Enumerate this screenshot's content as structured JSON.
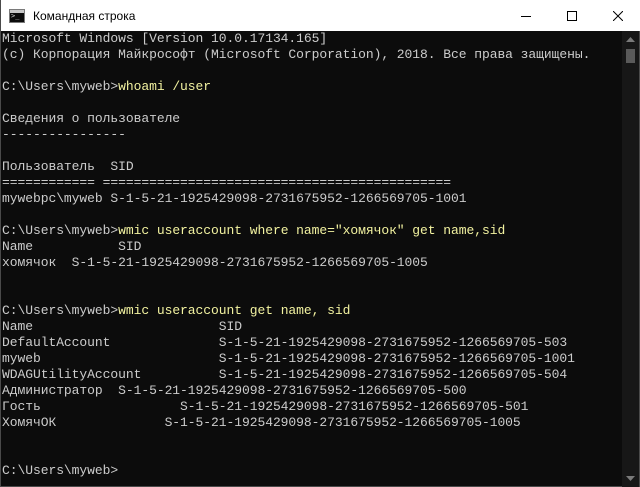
{
  "window": {
    "title": "Командная строка",
    "icon": "cmd-icon",
    "controls": [
      "minimize-icon",
      "maximize-icon",
      "close-icon"
    ]
  },
  "colors": {
    "background": "#0c0c0c",
    "text": "#cccccc",
    "command": "#f2f2a0",
    "titlebar": "#ffffff"
  },
  "console": {
    "header1": "Microsoft Windows [Version 10.0.17134.165]",
    "header2": "(c) Корпорация Майкрософт (Microsoft Corporation), 2018. Все права защищены.",
    "prompt1": "C:\\Users\\myweb>",
    "cmd1": "whoami /user",
    "info_title": "Сведения о пользователе",
    "info_rule": "----------------",
    "table_header": "Пользователь  SID",
    "table_rule": "============ =============================================",
    "table_row": "mywebpc\\myweb S-1-5-21-1925429098-2731675952-1266569705-1001",
    "prompt2": "C:\\Users\\myweb>",
    "cmd2": "wmic useraccount where name=\"хомячок\" get name,sid",
    "q2_header": "Name           SID",
    "q2_row": "хомячок  S-1-5-21-1925429098-2731675952-1266569705-1005",
    "prompt3": "C:\\Users\\myweb>",
    "cmd3": "wmic useraccount get name, sid",
    "q3_header": "Name                        SID",
    "q3_rows": [
      "DefaultAccount              S-1-5-21-1925429098-2731675952-1266569705-503",
      "myweb                       S-1-5-21-1925429098-2731675952-1266569705-1001",
      "WDAGUtilityAccount          S-1-5-21-1925429098-2731675952-1266569705-504",
      "Администратор  S-1-5-21-1925429098-2731675952-1266569705-500",
      "Гость                  S-1-5-21-1925429098-2731675952-1266569705-501",
      "ХомячОК              S-1-5-21-1925429098-2731675952-1266569705-1005"
    ],
    "prompt4": "C:\\Users\\myweb>"
  }
}
